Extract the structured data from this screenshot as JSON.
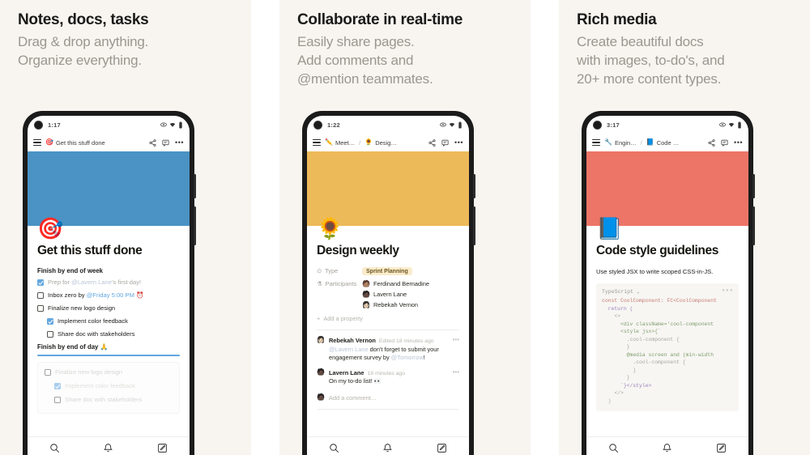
{
  "panels": [
    {
      "headline": "Notes, docs, tasks",
      "subline": "Drag & drop anything.\nOrganize everything.",
      "phone": {
        "clock": "1:17",
        "cover_color": "#4A93C4",
        "cover_emoji": "🎯",
        "breadcrumb": [
          {
            "icon": "🎯",
            "label": "Get this stuff done"
          }
        ],
        "page_title": "Get this stuff done",
        "sections": [
          {
            "heading": "Finish by end of week",
            "items": [
              {
                "checked": true,
                "indent": 0,
                "text": "Prep for ",
                "mention": "@Lavern Lane",
                "tail": "'s first day!",
                "done": true
              },
              {
                "checked": false,
                "indent": 0,
                "text": "Inbox zero by ",
                "date": "@Friday 5:00 PM ⏰",
                "done": false
              },
              {
                "checked": false,
                "indent": 0,
                "text": "Finalize new logo design",
                "done": false
              },
              {
                "checked": true,
                "indent": 1,
                "text": "Implement color feedback",
                "done": false
              },
              {
                "checked": false,
                "indent": 1,
                "text": "Share doc with stakeholders",
                "done": false
              }
            ]
          }
        ],
        "drag_section": {
          "heading": "Finish by end of day 🙏",
          "ghost_items": [
            {
              "checked": false,
              "indent": 0,
              "text": "Finalize new logo design"
            },
            {
              "checked": true,
              "indent": 1,
              "text": "Implement color feedback"
            },
            {
              "checked": false,
              "indent": 1,
              "text": "Share doc with stakeholders"
            }
          ]
        }
      }
    },
    {
      "headline": "Collaborate in real-time",
      "subline": "Easily share pages.\nAdd comments and\n@mention teammates.",
      "phone": {
        "clock": "1:22",
        "cover_color": "#EDBA5A",
        "cover_emoji": "🌻",
        "breadcrumb": [
          {
            "icon": "✏️",
            "label": "Meet…"
          },
          {
            "icon": "🌻",
            "label": "Desig…"
          }
        ],
        "page_title": "Design weekly",
        "properties": [
          {
            "icon": "⊙",
            "key": "Type",
            "chip": "Sprint Planning"
          },
          {
            "icon": "⚗",
            "key": "Participants",
            "people": [
              {
                "avatar": "🧑🏽",
                "name": "Ferdinand Bernadine"
              },
              {
                "avatar": "🧑🏿",
                "name": "Lavern Lane"
              },
              {
                "avatar": "👩🏻",
                "name": "Rebekah Vernon"
              }
            ]
          }
        ],
        "add_property": "Add a property",
        "comments": [
          {
            "avatar": "👩🏻",
            "name": "Rebekah Vernon",
            "time": "Edited 18 minutes ago",
            "mention": "@Lavern Lane",
            "text": " don't forget to submit your engagement survey by ",
            "date": "@Tomorrow",
            "tail": "!"
          },
          {
            "avatar": "🧑🏿",
            "name": "Lavern Lane",
            "time": "18 minutes ago",
            "text": "On my to-do list! 👀"
          }
        ],
        "add_comment": "Add a comment…",
        "add_comment_avatar": "🧑🏿"
      }
    },
    {
      "headline": "Rich media",
      "subline": "Create beautiful docs\nwith images, to-do's, and\n20+ more content types.",
      "phone": {
        "clock": "3:17",
        "cover_color": "#EC7567",
        "cover_emoji": "📘",
        "breadcrumb": [
          {
            "icon": "🔧",
            "label": "Engin…"
          },
          {
            "icon": "📘",
            "label": "Code …"
          }
        ],
        "page_title": "Code style guidelines",
        "paragraph": "Use styled JSX to write scoped CSS-in-JS.",
        "code": {
          "language": "TypeScript",
          "lines": [
            "const CoolComponent: FC<CoolComponent",
            "  return (",
            "    <>",
            "      <div className='cool-component",
            "      <style jsx>{`",
            "        .cool-component {",
            "        }",
            "        @media screen and (min-width",
            "          .cool-component {",
            "          }",
            "        }",
            "      `}</style>",
            "    </>",
            "  )"
          ]
        }
      }
    }
  ],
  "bottom_nav": [
    {
      "icon": "search-icon"
    },
    {
      "icon": "bell-icon"
    },
    {
      "icon": "compose-icon"
    }
  ],
  "colors": {
    "panel_bg": "#F8F5F0",
    "headline": "#1a1a18",
    "subline": "#9a9790",
    "accent_blue": "#63a7e0"
  }
}
